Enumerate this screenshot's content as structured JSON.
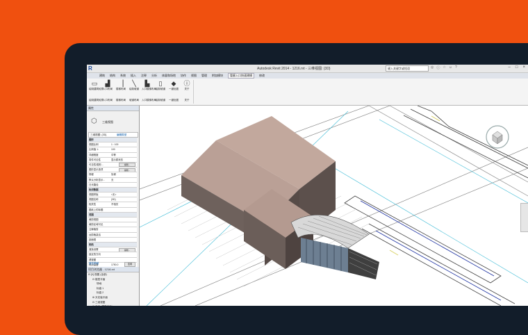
{
  "window": {
    "title": "Autodesk Revit 2014 -    1216.rvt - 三维视图: {3D}",
    "search_placeholder": "键入关键字或短语",
    "app_logo": "R",
    "controls": [
      "–",
      "□",
      "×"
    ],
    "quick_icons": [
      "binoculars-icon",
      "info-icon",
      "star-icon",
      "user-icon",
      "help-icon"
    ]
  },
  "tabs": [
    "建筑",
    "结构",
    "系统",
    "插入",
    "注释",
    "分析",
    "体量和场地",
    "协作",
    "视图",
    "管理",
    "附加模块",
    "管廊入口快速建模",
    "修改"
  ],
  "active_tab_index": 11,
  "ribbon": {
    "buttons": [
      {
        "icon": "wall-icon",
        "label": "绘制建筑轮廓",
        "sub": "绘制建筑轮廓"
      },
      {
        "icon": "floor-icon",
        "label": "入口布局",
        "sub": "入口布局"
      },
      {
        "icon": "beam-icon",
        "label": "楼梯布局",
        "sub": "楼梯布局"
      },
      {
        "icon": "line-icon",
        "label": "绘制坡道",
        "sub": "坡道布局"
      },
      {
        "icon": "stair-icon",
        "label": "入口楼梯布局",
        "sub": "入口楼梯布局"
      },
      {
        "icon": "door-icon",
        "label": "绘制坡道",
        "sub": "绘制坡道"
      },
      {
        "icon": "diamond-icon",
        "label": "一键出图",
        "sub": "一键出图"
      },
      {
        "icon": "info-icon",
        "label": "关于",
        "sub": "关于"
      }
    ]
  },
  "properties": {
    "header": "属性",
    "type_name": "三维视图",
    "filter_label": "三维视图: {3D}",
    "filter_action": "编辑类型",
    "rows": [
      {
        "k": "图形",
        "v": "",
        "section": true
      },
      {
        "k": "视图比例",
        "v": "1 : 100"
      },
      {
        "k": "比例值 1:",
        "v": "100"
      },
      {
        "k": "详细程度",
        "v": "中等"
      },
      {
        "k": "零件可见性",
        "v": "显示原状态"
      },
      {
        "k": "可见性/图形...",
        "v": "",
        "btn": "编辑..."
      },
      {
        "k": "图形显示选项",
        "v": "",
        "btn": "编辑..."
      },
      {
        "k": "规程",
        "v": "协调"
      },
      {
        "k": "默认分析显示...",
        "v": "无"
      },
      {
        "k": "日光路径",
        "v": ""
      },
      {
        "k": "标识数据",
        "v": "",
        "section": true
      },
      {
        "k": "视图样板",
        "v": "<无>"
      },
      {
        "k": "视图名称",
        "v": "{3D}"
      },
      {
        "k": "相关性",
        "v": "不相关"
      },
      {
        "k": "图纸上的标题",
        "v": ""
      },
      {
        "k": "范围",
        "v": "",
        "section": true
      },
      {
        "k": "裁剪视图",
        "v": ""
      },
      {
        "k": "裁剪区域可见",
        "v": ""
      },
      {
        "k": "注释裁剪",
        "v": ""
      },
      {
        "k": "远剪裁激活",
        "v": ""
      },
      {
        "k": "剖面框",
        "v": ""
      },
      {
        "k": "相机",
        "v": "",
        "section": true
      },
      {
        "k": "渲染设置",
        "v": "",
        "btn": "编辑..."
      },
      {
        "k": "锁定的方向",
        "v": ""
      },
      {
        "k": "透视图",
        "v": ""
      },
      {
        "k": "视点高度",
        "v": "1750.0"
      }
    ],
    "help_link": "属性帮助",
    "apply": "应用"
  },
  "browser": {
    "header": "项目浏览器 - 1216.rvt",
    "items": [
      {
        "t": "⊟ [0] 视图 (全部)",
        "d": 0
      },
      {
        "t": "⊟ 楼层平面",
        "d": 1
      },
      {
        "t": "场地",
        "d": 2
      },
      {
        "t": "标高 1",
        "d": 2
      },
      {
        "t": "标高 2",
        "d": 2
      },
      {
        "t": "⊞ 天花板平面",
        "d": 1
      },
      {
        "t": "⊟ 三维视图",
        "d": 1
      },
      {
        "t": "⊟ 立面 (建筑立面)",
        "d": 1
      },
      {
        "t": "东",
        "d": 2
      },
      {
        "t": "北",
        "d": 2
      },
      {
        "t": "南",
        "d": 2
      },
      {
        "t": "西",
        "d": 2
      }
    ]
  },
  "colors": {
    "background": "#f0500f",
    "bezel": "#121d2a",
    "building_roof": "#b99e94",
    "building_side": "#5c504c",
    "drawing_line": "#4a4a4a",
    "accent_cyan": "#3dbbd6"
  }
}
